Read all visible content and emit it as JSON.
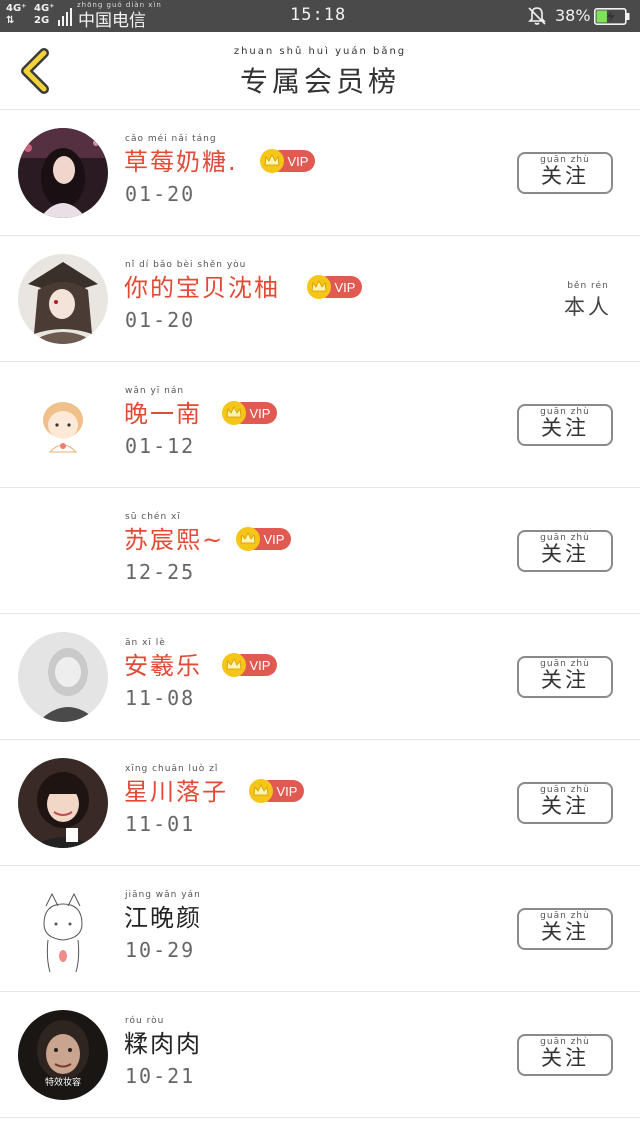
{
  "status_bar": {
    "sim1": "4G⁺",
    "sim1_sub": "⇅",
    "sim2": "4G⁺",
    "sim2_sub": "2G",
    "carrier": "中国电信",
    "carrier_pinyin": "zhōng guó diàn xìn",
    "time": "15:18",
    "battery_percent": "38%",
    "battery_level": 0.38,
    "battery_color": "#7fe35a"
  },
  "header": {
    "title": "专属会员榜",
    "title_pinyin": "zhuan shǔ huì yuán bǎng",
    "back_icon": "chevron-left-icon",
    "back_color": "#f2d33a"
  },
  "vip_badge": {
    "label": "VIP",
    "color": "#e05a52",
    "crown_color": "#f5c518"
  },
  "members": [
    {
      "name": "草莓奶糖.",
      "name_pinyin": "cǎo méi nǎi táng",
      "vip": true,
      "date": "01-20",
      "action": "关注",
      "action_pinyin": "guān zhù"
    },
    {
      "name": "你的宝贝沈柚",
      "name_pinyin": "nǐ  dí  bǎo  bèi shěn yòu",
      "vip": true,
      "date": "01-20",
      "action": "本人",
      "action_pinyin": "běn  rén"
    },
    {
      "name": "晚一南",
      "name_pinyin": "wǎn  yī  nán",
      "vip": true,
      "date": "01-12",
      "action": "关注",
      "action_pinyin": "guān zhù"
    },
    {
      "name": "苏宸熙~",
      "name_pinyin": "sū chén  xī",
      "vip": true,
      "date": "12-25",
      "action": "关注",
      "action_pinyin": "guān zhù"
    },
    {
      "name": "安羲乐",
      "name_pinyin": "ān  xī  lè",
      "vip": true,
      "date": "11-08",
      "action": "关注",
      "action_pinyin": "guān zhù"
    },
    {
      "name": "星川落子",
      "name_pinyin": "xīng chuān luò  zǐ",
      "vip": true,
      "date": "11-01",
      "action": "关注",
      "action_pinyin": "guān zhù"
    },
    {
      "name": "江晚颜",
      "name_pinyin": "jiāng wǎn yán",
      "vip": false,
      "date": "10-29",
      "action": "关注",
      "action_pinyin": "guān zhù"
    },
    {
      "name": "糅肉肉",
      "name_pinyin": "róu  ròu",
      "vip": false,
      "date": "10-21",
      "action": "关注",
      "action_pinyin": "guān zhù",
      "avatar_caption": "特效妆容"
    }
  ]
}
